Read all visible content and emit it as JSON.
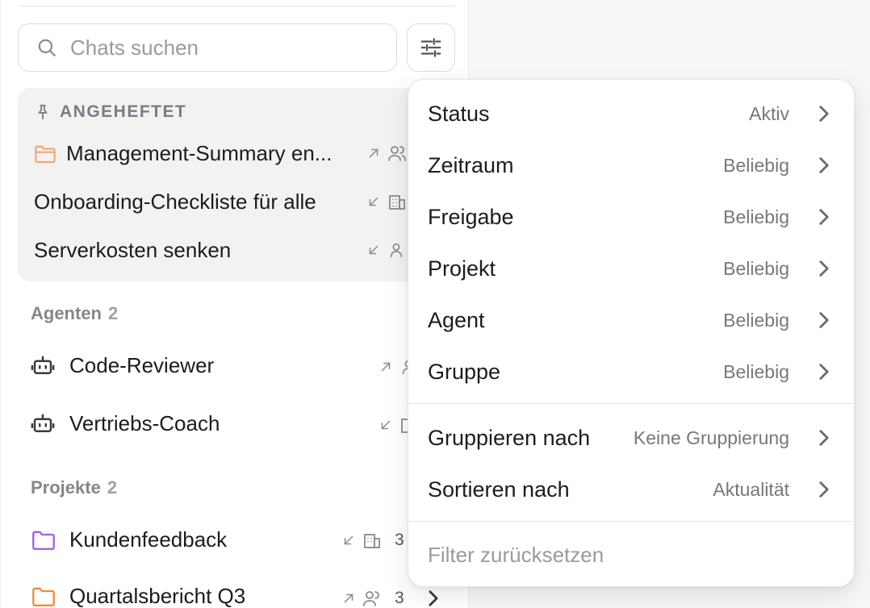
{
  "search": {
    "placeholder": "Chats suchen"
  },
  "pinned": {
    "header": "ANGEHEFTET",
    "items": [
      {
        "label": "Management-Summary en...",
        "icon": "folder-icon",
        "direction": "outgoing",
        "share": "group"
      },
      {
        "label": "Onboarding-Checkliste für alle",
        "direction": "incoming",
        "share": "organization"
      },
      {
        "label": "Serverkosten senken",
        "direction": "incoming",
        "share": "user"
      }
    ]
  },
  "agents": {
    "title": "Agenten",
    "count": "2",
    "items": [
      {
        "label": "Code-Reviewer",
        "direction": "outgoing",
        "share": "user"
      },
      {
        "label": "Vertriebs-Coach",
        "direction": "incoming",
        "share": "organization"
      }
    ]
  },
  "projects": {
    "title": "Projekte",
    "count": "2",
    "items": [
      {
        "label": "Kundenfeedback",
        "count": "3",
        "color": "#a35de8"
      },
      {
        "label": "Quartalsbericht Q3",
        "count": "3",
        "color": "#ef8a3c"
      }
    ]
  },
  "filter_menu": {
    "items": [
      {
        "label": "Status",
        "value": "Aktiv"
      },
      {
        "label": "Zeitraum",
        "value": "Beliebig"
      },
      {
        "label": "Freigabe",
        "value": "Beliebig"
      },
      {
        "label": "Projekt",
        "value": "Beliebig"
      },
      {
        "label": "Agent",
        "value": "Beliebig"
      },
      {
        "label": "Gruppe",
        "value": "Beliebig"
      }
    ],
    "group_by": {
      "label": "Gruppieren nach",
      "value": "Keine Gruppierung"
    },
    "sort_by": {
      "label": "Sortieren nach",
      "value": "Aktualität"
    },
    "reset_label": "Filter zurücksetzen"
  },
  "colors": {
    "pinned_folder": "#f3a66b",
    "muted_icon": "#8a8a8f"
  }
}
